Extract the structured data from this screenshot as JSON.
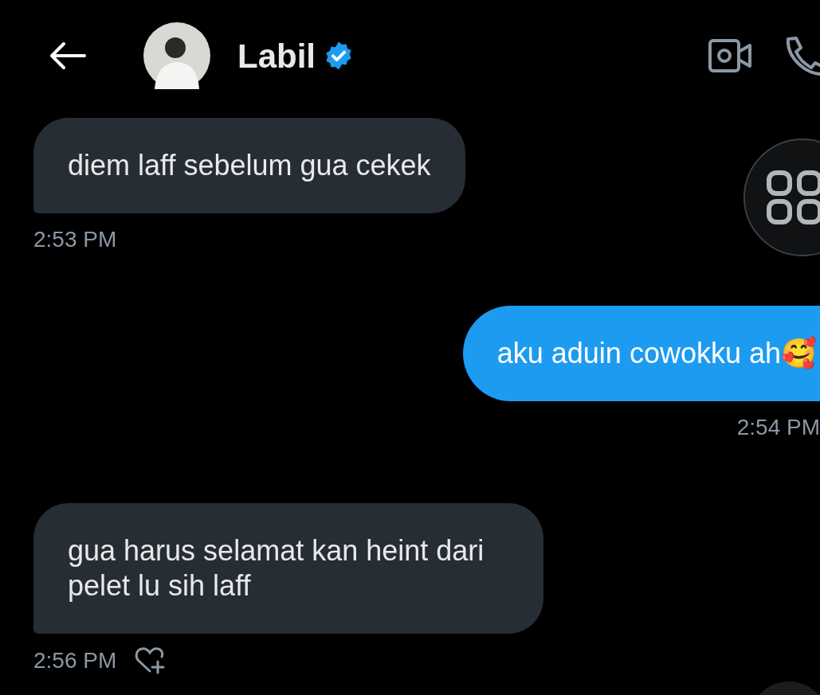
{
  "header": {
    "title": "Labil",
    "verified": true
  },
  "messages": [
    {
      "kind": "received",
      "text": "diem laff sebelum gua cekek",
      "time": "2:53 PM",
      "react": false
    },
    {
      "kind": "sent",
      "text": "aku aduin cowokku ah🥰",
      "time": "2:54 PM",
      "react": false
    },
    {
      "kind": "received",
      "text": "gua harus selamat kan heint dari pelet lu sih laff",
      "time": "2:56 PM",
      "react": true
    }
  ]
}
